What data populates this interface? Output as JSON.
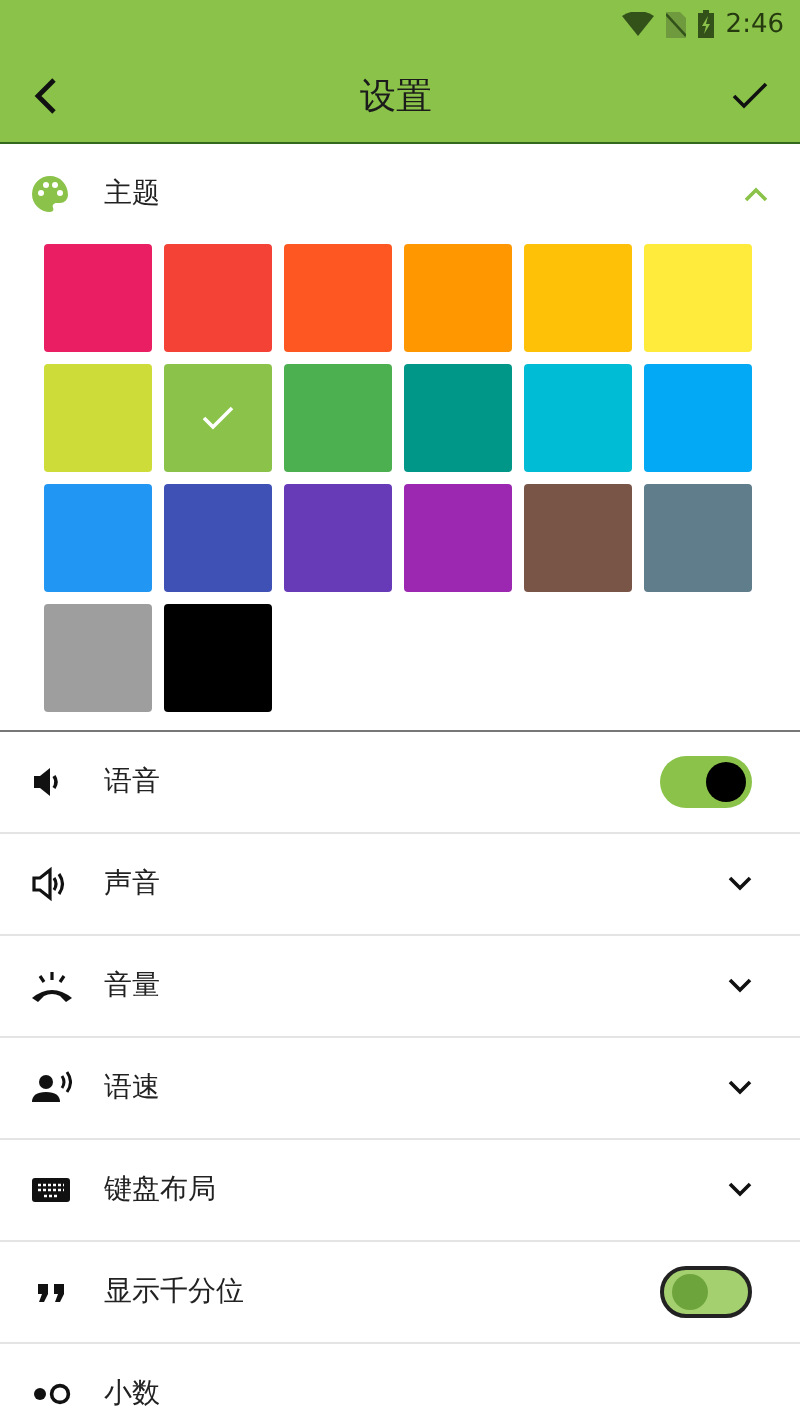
{
  "status_bar": {
    "time": "2:46"
  },
  "toolbar": {
    "title": "设置"
  },
  "theme": {
    "title": "主题",
    "expanded": true,
    "swatches": [
      {
        "color": "#e91e63",
        "selected": false
      },
      {
        "color": "#f44336",
        "selected": false
      },
      {
        "color": "#ff5722",
        "selected": false
      },
      {
        "color": "#ff9800",
        "selected": false
      },
      {
        "color": "#ffc107",
        "selected": false
      },
      {
        "color": "#ffeb3b",
        "selected": false
      },
      {
        "color": "#cddc39",
        "selected": false
      },
      {
        "color": "#8bc34a",
        "selected": true
      },
      {
        "color": "#4caf50",
        "selected": false
      },
      {
        "color": "#009688",
        "selected": false
      },
      {
        "color": "#00bcd4",
        "selected": false
      },
      {
        "color": "#03a9f4",
        "selected": false
      },
      {
        "color": "#2196f3",
        "selected": false
      },
      {
        "color": "#3f51b5",
        "selected": false
      },
      {
        "color": "#673ab7",
        "selected": false
      },
      {
        "color": "#9c27b0",
        "selected": false
      },
      {
        "color": "#795548",
        "selected": false
      },
      {
        "color": "#607d8b",
        "selected": false
      },
      {
        "color": "#9e9e9e",
        "selected": false
      },
      {
        "color": "#000000",
        "selected": false
      }
    ]
  },
  "settings": [
    {
      "label": "语音",
      "kind": "toggle",
      "on": true
    },
    {
      "label": "声音",
      "kind": "expand",
      "expanded": false
    },
    {
      "label": "音量",
      "kind": "expand",
      "expanded": false
    },
    {
      "label": "语速",
      "kind": "expand",
      "expanded": false
    },
    {
      "label": "键盘布局",
      "kind": "expand",
      "expanded": false
    },
    {
      "label": "显示千分位",
      "kind": "toggle",
      "on": false
    },
    {
      "label": "小数",
      "kind": "plain"
    }
  ]
}
